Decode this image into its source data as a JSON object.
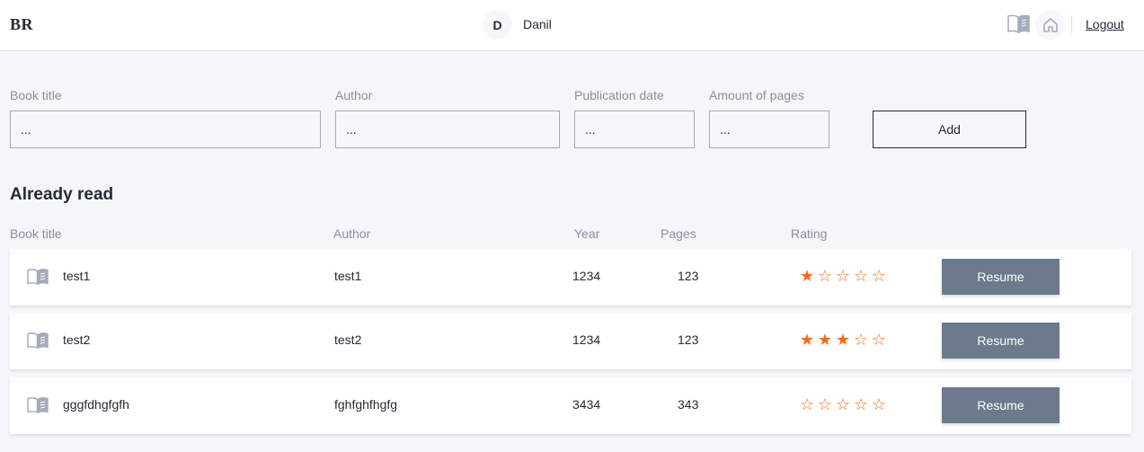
{
  "header": {
    "logo": "BR",
    "avatar_initial": "D",
    "username": "Danil",
    "logout_label": "Logout"
  },
  "form": {
    "title_label": "Book title",
    "title_placeholder": "...",
    "author_label": "Author",
    "author_placeholder": "...",
    "date_label": "Publication date",
    "date_placeholder": "...",
    "pages_label": "Amount of pages",
    "pages_placeholder": "...",
    "add_label": "Add"
  },
  "section": {
    "title": "Already read",
    "columns": {
      "title": "Book title",
      "author": "Author",
      "year": "Year",
      "pages": "Pages",
      "rating": "Rating"
    }
  },
  "books": [
    {
      "title": "test1",
      "author": "test1",
      "year": "1234",
      "pages": "123",
      "rating": 1,
      "action": "Resume"
    },
    {
      "title": "test2",
      "author": "test2",
      "year": "1234",
      "pages": "123",
      "rating": 3,
      "action": "Resume"
    },
    {
      "title": "gggfdhgfgfh",
      "author": "fghfghfhgfg",
      "year": "3434",
      "pages": "343",
      "rating": 0,
      "action": "Resume"
    }
  ],
  "rating_max": 5,
  "colors": {
    "accent": "#ff6b08",
    "button_gray": "#6d7a8d",
    "text": "#242a37",
    "muted": "#898f9f"
  }
}
